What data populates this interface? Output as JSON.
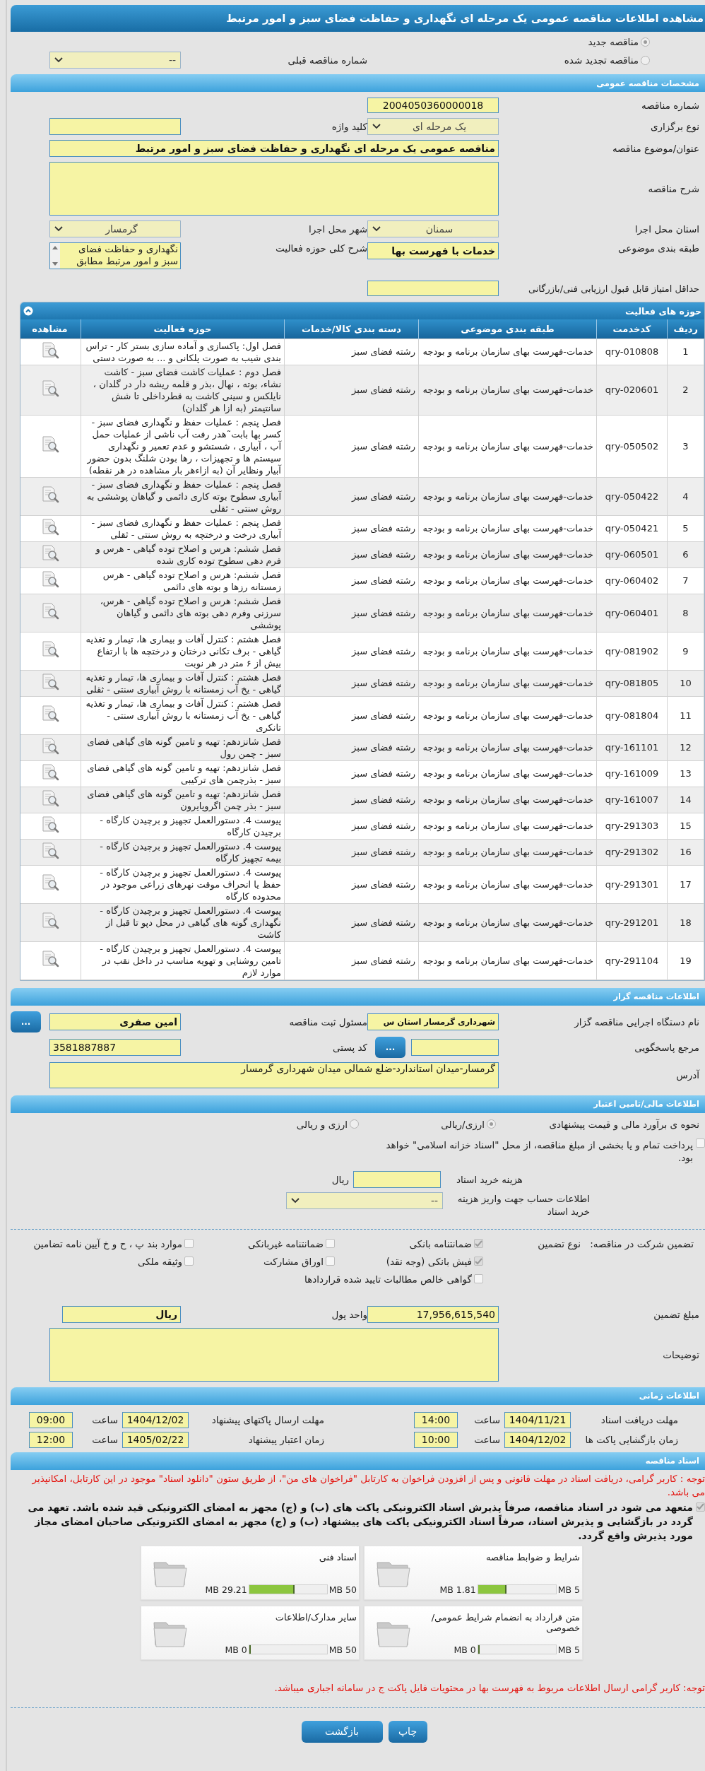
{
  "title": "مشاهده اطلاعات مناقصه عمومی یک مرحله ای نگهداری و حفاظت فضای سبز و امور مرتبط",
  "tender_kind": [
    {
      "label": "مناقصه جدید",
      "selected": true
    },
    {
      "label": "مناقصه تجدید شده",
      "selected": false
    }
  ],
  "previous_tender": {
    "label": "شماره مناقصه قبلی",
    "value": "--"
  },
  "general": {
    "header": "مشخصات مناقصه عمومی",
    "tender_number": {
      "label": "شماره مناقصه",
      "value": "2004050360000018"
    },
    "holding_type": {
      "label": "نوع برگزاری",
      "value": "یک مرحله ای"
    },
    "keyword": {
      "label": "کلید واژه"
    },
    "subject": {
      "label": "عنوان/موضوع مناقصه",
      "value": "مناقصه عمومی یک مرحله ای نگهداری و حفاظت فضای سبز و امور مرتبط"
    },
    "description": {
      "label": "شرح مناقصه"
    },
    "province": {
      "label": "استان محل اجرا",
      "value": "سمنان"
    },
    "city": {
      "label": "شهر محل اجرا",
      "value": "گرمسار"
    },
    "category": {
      "label": "طبقه بندی موضوعی",
      "value": "خدمات با فهرست بها"
    },
    "activity_summary": {
      "label": "شرح کلی حوزه فعالیت",
      "value": "نگهداری و حفاظت فضای سبز و امور مرتبط مطابق"
    },
    "min_score": {
      "label": "حداقل امتیاز قابل قبول ارزیابی فنی/بازرگانی"
    }
  },
  "activities": {
    "header": "حوزه های فعالیت",
    "columns": [
      "ردیف",
      "کدخدمت",
      "طبقه بندی موضوعی",
      "دسته بندی کالا/خدمات",
      "حوزه فعالیت",
      "مشاهده"
    ],
    "rows": [
      {
        "index": "1",
        "code": "qry-010808",
        "category": "خدمات-فهرست بهای سازمان برنامه و بودجه",
        "group": "رشته فضای سبز",
        "activity": "فصل اول:  پاکسازی و آماده سازی بستر کار - تراس بندی شیب به صورت پلکانی و ... به صورت دستی"
      },
      {
        "index": "2",
        "code": "qry-020601",
        "category": "خدمات-فهرست بهای سازمان برنامه و بودجه",
        "group": "رشته فضای سبز",
        "activity": "فصل دوم : عملیات کاشت فضای سبز -  کاشت نشاء، بوته ، نهال ،بذر و قلمه ریشه دار در گلدان ، نایلکس و سینی کاشت به قطرداخلی تا شش سانتیمتر (به ازا هر  گلدان)"
      },
      {
        "index": "3",
        "code": "qry-050502",
        "category": "خدمات-فهرست بهای سازمان برنامه و بودجه",
        "group": "رشته فضای سبز",
        "activity": "فصل پنجم : عملیات حفظ و نگهداری فضای سبز - کسر بها بابت˜هدر رفت آب ناشی از عملیات حمل آب ، آبیاری ، شستشو و عدم تعمیر و نگهداری سیستم ها و تجهیزات ، رها بودن شلنگ بدون حضور آبیار ونظایر آن (به ازاءهر بار مشاهده در هر نقطه)"
      },
      {
        "index": "4",
        "code": "qry-050422",
        "category": "خدمات-فهرست بهای سازمان برنامه و بودجه",
        "group": "رشته فضای سبز",
        "activity": "فصل پنجم : عملیات حفظ و نگهداری فضای سبز - آبیاری سطوح بوته کاری دائمی  و گیاهان پوششی به روش سنتی - ثقلی"
      },
      {
        "index": "5",
        "code": "qry-050421",
        "category": "خدمات-فهرست بهای سازمان برنامه و بودجه",
        "group": "رشته فضای سبز",
        "activity": "فصل پنجم : عملیات حفظ و نگهداری فضای سبز - آبیاری درخت و درختچه به روش  سنتی - ثقلی"
      },
      {
        "index": "6",
        "code": "qry-060501",
        "category": "خدمات-فهرست بهای سازمان برنامه و بودجه",
        "group": "رشته فضای سبز",
        "activity": "فصل ششم: هرس و اصلاح توده گیاهی - هرس و فرم دهی سطوح توده کاری شده"
      },
      {
        "index": "7",
        "code": "qry-060402",
        "category": "خدمات-فهرست بهای سازمان برنامه و بودجه",
        "group": "رشته فضای سبز",
        "activity": "فصل ششم: هرس و اصلاح توده گیاهی - هرس زمستانه رزها و بوته های دائمی"
      },
      {
        "index": "8",
        "code": "qry-060401",
        "category": "خدمات-فهرست بهای سازمان برنامه و بودجه",
        "group": "رشته فضای سبز",
        "activity": "فصل ششم: هرس و اصلاح توده گیاهی - هرس، سرزنی  وفرم دهی بوته های دائمی و گیاهان پوششی"
      },
      {
        "index": "9",
        "code": "qry-081902",
        "category": "خدمات-فهرست بهای سازمان برنامه و بودجه",
        "group": "رشته فضای سبز",
        "activity": "فصل هشتم : کنترل آفات و بیماری ها، تیمار و تغذیه گیاهی - برف تکانی درختان و درختچه ها با ارتفاع بیش از ۶ متر در هر نوبت"
      },
      {
        "index": "10",
        "code": "qry-081805",
        "category": "خدمات-فهرست بهای سازمان برنامه و بودجه",
        "group": "رشته فضای سبز",
        "activity": "فصل هشتم : کنترل آفات و بیماری ها، تیمار و تغذیه گیاهی - یخ آب زمستانه با روش آبیاری سنتی - ثقلی"
      },
      {
        "index": "11",
        "code": "qry-081804",
        "category": "خدمات-فهرست بهای سازمان برنامه و بودجه",
        "group": "رشته فضای سبز",
        "activity": "فصل هشتم : کنترل آفات و بیماری ها، تیمار و تغذیه گیاهی - یخ آب زمستانه با روش آبیاری سنتی - تانکری"
      },
      {
        "index": "12",
        "code": "qry-161101",
        "category": "خدمات-فهرست بهای سازمان برنامه و بودجه",
        "group": "رشته فضای سبز",
        "activity": "فصل شانزدهم: تهیه و تامین گونه های گیاهی فضای سبز - چمن رول"
      },
      {
        "index": "13",
        "code": "qry-161009",
        "category": "خدمات-فهرست بهای سازمان برنامه و بودجه",
        "group": "رشته فضای سبز",
        "activity": "فصل شانزدهم: تهیه و تامین گونه های گیاهی فضای سبز - بذرچمن های ترکیبی"
      },
      {
        "index": "14",
        "code": "qry-161007",
        "category": "خدمات-فهرست بهای سازمان برنامه و بودجه",
        "group": "رشته فضای سبز",
        "activity": "فصل شانزدهم: تهیه و تامین گونه های گیاهی فضای سبز - بذر چمن اگروپایرون"
      },
      {
        "index": "15",
        "code": "qry-291303",
        "category": "خدمات-فهرست بهای سازمان برنامه و بودجه",
        "group": "رشته فضای سبز",
        "activity": "پیوست 4. دستورالعمل تجهیز و برچیدن کارگاه - برچیدن کارگاه"
      },
      {
        "index": "16",
        "code": "qry-291302",
        "category": "خدمات-فهرست بهای سازمان برنامه و بودجه",
        "group": "رشته فضای سبز",
        "activity": "پیوست 4. دستورالعمل تجهیز و برچیدن کارگاه - بیمه تجهیز کارگاه"
      },
      {
        "index": "17",
        "code": "qry-291301",
        "category": "خدمات-فهرست بهای سازمان برنامه و بودجه",
        "group": "رشته فضای سبز",
        "activity": "پیوست 4. دستورالعمل تجهیز و برچیدن کارگاه - حفظ یا انحراف موقت نهرهای زراعی موجود در محدوده کارگاه"
      },
      {
        "index": "18",
        "code": "qry-291201",
        "category": "خدمات-فهرست بهای سازمان برنامه و بودجه",
        "group": "رشته فضای سبز",
        "activity": "پیوست 4. دستورالعمل تجهیز و برچیدن کارگاه - نگهداری گونه های گیاهی در محل دپو تا قبل از کاشت"
      },
      {
        "index": "19",
        "code": "qry-291104",
        "category": "خدمات-فهرست بهای سازمان برنامه و بودجه",
        "group": "رشته فضای سبز",
        "activity": "پیوست 4. دستورالعمل تجهیز و برچیدن کارگاه - تامین روشنایی و تهویه مناسب در داخل نقب در موارد لازم"
      }
    ]
  },
  "organizer": {
    "header": "اطلاعات مناقصه گزار",
    "org_name": {
      "label": "نام دستگاه اجرایی مناقصه گزار",
      "value": "شهرداری گرمسار استان س"
    },
    "registrar": {
      "label": "مسئول ثبت مناقصه",
      "value": "امین صفری",
      "button": "..."
    },
    "response_ref": {
      "label": "مرجع پاسخگویی",
      "button": "..."
    },
    "postal_code": {
      "label": "کد پستی",
      "value": "3581887887"
    },
    "address": {
      "label": "آدرس",
      "value": "گرمسار-میدان استاندارد-ضلع شمالی میدان شهرداری گرمسار"
    }
  },
  "financial": {
    "header": "اطلاعات مالی/تامین اعتبار",
    "estimate": {
      "label": "نحوه ی برآورد مالی و قیمت پیشنهادی",
      "options": [
        {
          "label": "ارزی/ریالی",
          "selected": true
        },
        {
          "label": "ارزی و ریالی",
          "selected": false
        }
      ]
    },
    "treasury": {
      "label": "پرداخت تمام و یا بخشی از مبلغ مناقصه، از محل \"اسناد خزانه اسلامی\" خواهد بود.",
      "checked": false
    },
    "document_fee": {
      "label": "هزینه خرید اسناد",
      "unit": "ریال"
    },
    "account": {
      "label": "اطلاعات حساب جهت واریز هزینه خرید اسناد",
      "value": "--"
    },
    "guarantee": {
      "label": "تضمین شرکت در مناقصه:",
      "type_label": "نوع تضمین",
      "options": [
        {
          "label": "ضمانتنامه بانکی",
          "checked": true
        },
        {
          "label": "ضمانتنامه غیربانکی",
          "checked": false
        },
        {
          "label": "موارد بند پ ، ح و خ آیین نامه تضامین",
          "checked": false
        },
        {
          "label": "فیش بانکی (وجه نقد)",
          "checked": true
        },
        {
          "label": "اوراق مشارکت",
          "checked": false
        },
        {
          "label": "وثیقه ملکی",
          "checked": false
        },
        {
          "label": "گواهی خالص مطالبات تایید شده قراردادها",
          "checked": false
        }
      ]
    },
    "amount": {
      "label": "مبلغ تضمین",
      "value": "17,956,615,540"
    },
    "currency": {
      "label": "واحد پول",
      "value": "ریال"
    },
    "notes": {
      "label": "توضیحات"
    }
  },
  "timing": {
    "header": "اطلاعات زمانی",
    "items": [
      {
        "label": "مهلت دریافت اسناد",
        "date": "1404/11/21",
        "time_label": "ساعت",
        "time": "14:00"
      },
      {
        "label": "مهلت ارسال پاکتهای پیشنهاد",
        "date": "1404/12/02",
        "time_label": "ساعت",
        "time": "09:00"
      },
      {
        "label": "زمان بازگشایی پاکت ها",
        "date": "1404/12/02",
        "time_label": "ساعت",
        "time": "10:00"
      },
      {
        "label": "زمان اعتبار پیشنهاد",
        "date": "1405/02/22",
        "time_label": "ساعت",
        "time": "12:00"
      }
    ]
  },
  "documents": {
    "header": "اسناد مناقصه",
    "notice": "توجه : کاربر گرامی، دریافت اسناد در مهلت قانونی و پس از افزودن فراخوان به کارتابل \"فراخوان های من\"، از طریق ستون \"دانلود اسناد\" موجود در این کارتابل، امکانپذیر می باشد.",
    "commitment": {
      "label": "متعهد می شود در اسناد مناقصه، صرفاً پذیرش اسناد الکترونیکی پاکت های (ب) و (ج) مجهز به امضای الکترونیکی قید شده باشد. تعهد می گردد در بازگشایی و پذیرش اسناد، صرفاً اسناد الکترونیکی پاکت های پیشنهاد (ب) و (ج) مجهز به امضای الکترونیکی صاحبان امضای مجاز مورد پذیرش واقع گردد.",
      "checked": true
    },
    "files": [
      {
        "name": "شرایط و ضوابط مناقصه",
        "size": "1.81 MB",
        "max": "5 MB",
        "level": 0.362
      },
      {
        "name": "اسناد فنی",
        "size": "29.21 MB",
        "max": "50 MB",
        "level": 0.584
      },
      {
        "name": "متن قرارداد به انضمام شرایط عمومی/خصوصی",
        "size": "0 MB",
        "max": "5 MB",
        "level": 0
      },
      {
        "name": "سایر مدارک/اطلاعات",
        "size": "0 MB",
        "max": "50 MB",
        "level": 0
      }
    ],
    "footer_notice": "توجه: کاربر گرامی ارسال اطلاعات مربوط به فهرست بها در محتویات فایل پاکت ج در سامانه اجباری میباشد."
  },
  "buttons": [
    "چاپ",
    "بازگشت"
  ]
}
